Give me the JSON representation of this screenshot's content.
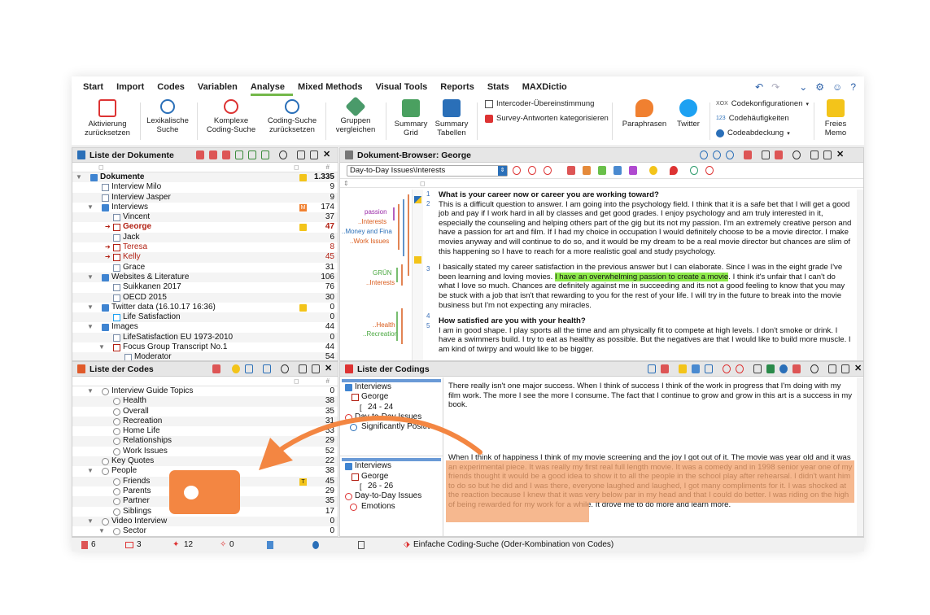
{
  "menubar": {
    "tabs": [
      "Start",
      "Import",
      "Codes",
      "Variablen",
      "Analyse",
      "Mixed Methods",
      "Visual Tools",
      "Reports",
      "Stats",
      "MAXDictio"
    ],
    "active": "Analyse"
  },
  "ribbon": {
    "aktivierung": "Aktivierung zurücksetzen",
    "lexikalische": "Lexikalische Suche",
    "komplexe": "Komplexe Coding-Suche",
    "coding_suche_zurueck": "Coding-Suche zurücksetzen",
    "gruppen": "Gruppen vergleichen",
    "summary_grid": "Summary Grid",
    "summary_tabellen": "Summary Tabellen",
    "intercoder": "Intercoder-Übereinstimmung",
    "survey": "Survey-Antworten kategorisieren",
    "paraphrasen": "Paraphrasen",
    "twitter": "Twitter",
    "codekonfig": "Codekonfigurationen",
    "codehaeuf": "Codehäufigkeiten",
    "codeabdeck": "Codeabdeckung",
    "freies_memo": "Freies Memo",
    "codekonfig_prefix": "XOX",
    "codehaeuf_prefix": "123"
  },
  "docs": {
    "title": "Liste der Dokumente",
    "rows": [
      {
        "label": "Dokumente",
        "count": "1.335"
      },
      {
        "label": "Interview Milo",
        "count": "9"
      },
      {
        "label": "Interview Jasper",
        "count": "9"
      },
      {
        "label": "Interviews",
        "count": "174"
      },
      {
        "label": "Vincent",
        "count": "37"
      },
      {
        "label": "George",
        "count": "47"
      },
      {
        "label": "Jack",
        "count": "6"
      },
      {
        "label": "Teresa",
        "count": "8"
      },
      {
        "label": "Kelly",
        "count": "45"
      },
      {
        "label": "Grace",
        "count": "31"
      },
      {
        "label": "Websites & Literature",
        "count": "106"
      },
      {
        "label": "Suikkanen 2017",
        "count": "76"
      },
      {
        "label": "OECD 2015",
        "count": "30"
      },
      {
        "label": "Twitter data (16.10.17 16:36)",
        "count": "0"
      },
      {
        "label": "Life Satisfaction",
        "count": "0"
      },
      {
        "label": "Images",
        "count": "44"
      },
      {
        "label": "LifeSatisfaction EU 1973-2010",
        "count": "0"
      },
      {
        "label": "Focus Group Transcript No.1",
        "count": "44"
      },
      {
        "label": "Moderator",
        "count": "54"
      }
    ]
  },
  "codes": {
    "title": "Liste der Codes",
    "rows": [
      {
        "label": "Interview Guide Topics",
        "count": "0"
      },
      {
        "label": "Health",
        "count": "38"
      },
      {
        "label": "Overall",
        "count": "35"
      },
      {
        "label": "Recreation",
        "count": "31"
      },
      {
        "label": "Home Life",
        "count": "53"
      },
      {
        "label": "Relationships",
        "count": "29"
      },
      {
        "label": "Work Issues",
        "count": "52"
      },
      {
        "label": "Key Quotes",
        "count": "22"
      },
      {
        "label": "People",
        "count": "38"
      },
      {
        "label": "Friends",
        "count": "45"
      },
      {
        "label": "Parents",
        "count": "29"
      },
      {
        "label": "Partner",
        "count": "35"
      },
      {
        "label": "Siblings",
        "count": "17"
      },
      {
        "label": "Video Interview",
        "count": "0"
      },
      {
        "label": "Sector",
        "count": "0"
      }
    ]
  },
  "browser": {
    "title": "Dokument-Browser: George",
    "dropdown": "Day-to-Day Issues\\Interests",
    "codes": [
      "passion",
      "..Interests",
      "..Money and Fina",
      "..Work Issues",
      "GRÜN",
      "..Interests",
      "..Health",
      "..Recreation"
    ],
    "line_nums": [
      "1",
      "2",
      "3",
      "4",
      "5"
    ],
    "p1_q": "What is your career now or career you are working toward?",
    "p1": "This is a difficult question to answer. I am going into the psychology field. I think that it is a safe bet that I will get a good job and pay if I work hard in all by classes and get good grades. I enjoy psychology and am truly interested in it, especially the counseling and helping others part of the gig but its not my passion. I'm an extremely creative person and have a passion for art and film. If I had my choice in occupation I would definitely choose to be a movie director. I make movies anyway and will continue to do so, and it would be my dream to be a real movie director but chances are slim of this happening so I have to reach for a more realistic goal and study psychology.",
    "p2a": "I basically stated my career satisfaction in the previous answer but I can elaborate. Since I was in the eight grade I've been learning and loving movies. ",
    "p2hl": "I have an overwhelming passion to create a movie",
    "p2b": ". I think it's unfair that I can't do what I love so much. Chances are definitely against me in succeeding and its not a good feeling to know that you may be stuck with a job that isn't that rewarding to you for the rest of your life. I will try in the future to break into the movie business but I'm not expecting any miracles.",
    "p3_q": "How satisfied are you with your health?",
    "p3": "I am in good shape. I play sports all the time and am physically fit to compete at high levels. I don't smoke or drink. I have a swimmers build. I try to eat as healthy as possible. But the negatives are that I would like to build more muscle. I am kind of twirpy and would like to be bigger."
  },
  "codings": {
    "title": "Liste der Codings",
    "s1": {
      "folder": "Interviews",
      "doc": "George",
      "range": "24 - 24",
      "code1": "Day-to-Day Issues",
      "code2": "Significantly Positive"
    },
    "s2": {
      "folder": "Interviews",
      "doc": "George",
      "range": "26 - 26",
      "code1": "Day-to-Day Issues",
      "code2": "Emotions"
    },
    "t1": "There really isn't one major success. When I think of success I think of the work in progress that I'm doing with my film work. The more I see the more I consume. The fact that I continue to grow and grow in this art is a success in my book.",
    "t2": "When I think of happiness I think of my movie screening and the joy I got out of it. The movie was year old and it was an experimental piece.  It was really my first real full length movie. It was a comedy and in 1998 senior year one of my friends thought it would be a good idea to show it to all the people in the school play after rehearsal. I didn't want him to do so but he did and I was there, everyone laughed and laughed, I got many compliments for it. I was shocked at the reaction because I knew that it was very below par in my head and that I could do better. I was riding on the high of being rewarded for my work for a while. It drove me to do more and learn more."
  },
  "status": {
    "docs": "6",
    "codes": "3",
    "codings": "12",
    "activated": "0",
    "search": "Einfache Coding-Suche (Oder-Kombination von Codes)"
  },
  "colors": {
    "accent": "#74b84a",
    "orange": "#f38642",
    "highlight": "#8dea4b",
    "red": "#b21f12",
    "blue": "#3f84d1"
  }
}
